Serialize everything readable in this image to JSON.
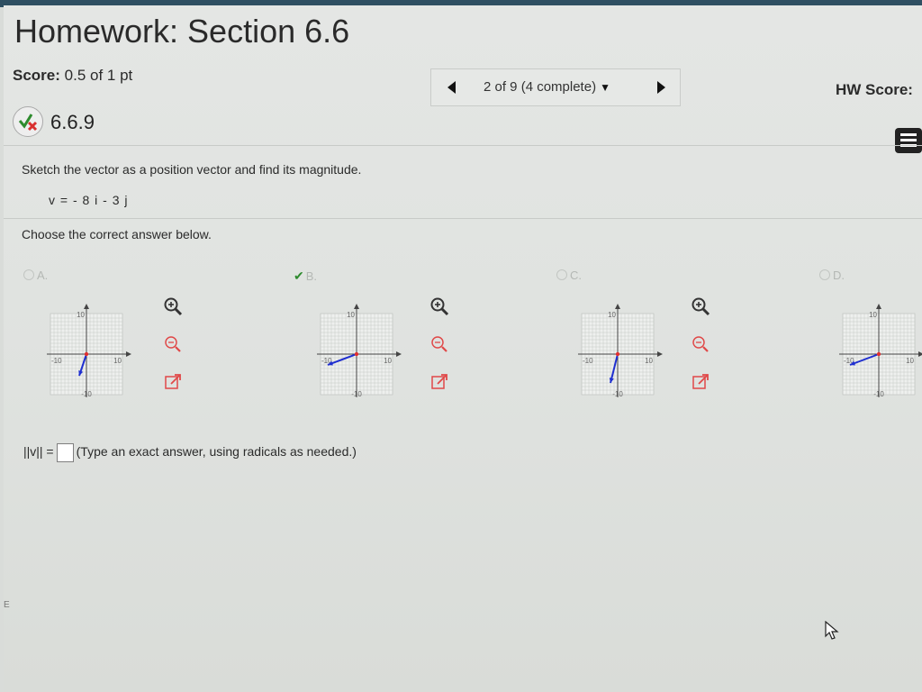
{
  "header": {
    "title": "Homework: Section 6.6",
    "score_label": "Score:",
    "score_value": "0.5 of 1 pt",
    "hw_score_label": "HW Score:"
  },
  "navigation": {
    "position_text": "2 of 9 (4 complete)",
    "dropdown_glyph": "▼"
  },
  "question": {
    "number": "6.6.9",
    "prompt": "Sketch the vector as a position vector and find its magnitude.",
    "equation": "v = - 8 i - 3 j",
    "instruction": "Choose the correct answer below."
  },
  "choices": [
    {
      "label": "A.",
      "selected": false,
      "ticks": {
        "top": "10",
        "left": "-10",
        "right": "10",
        "bottom": "-10"
      },
      "vector": [
        -2,
        -6
      ]
    },
    {
      "label": "B.",
      "selected": true,
      "ticks": {
        "top": "10",
        "left": "-10",
        "right": "10",
        "bottom": "-10"
      },
      "vector": [
        -8,
        -3
      ]
    },
    {
      "label": "C.",
      "selected": false,
      "ticks": {
        "top": "10",
        "left": "-10",
        "right": "10",
        "bottom": "-10"
      },
      "vector": [
        -2,
        -8
      ]
    },
    {
      "label": "D.",
      "selected": false,
      "ticks": {
        "top": "10",
        "left": "-10",
        "right": "10",
        "bottom": "-10"
      },
      "vector": [
        -8,
        -3
      ]
    }
  ],
  "answer": {
    "label": "||v|| =",
    "value": "",
    "hint": "(Type an exact answer, using radicals as needed.)"
  },
  "icons": {
    "incorrect_badge": "partial-check-icon",
    "list": "list-icon",
    "zoom_in": "zoom-in-icon",
    "zoom_out": "zoom-out-icon",
    "popout": "popout-icon",
    "cursor": "mouse-cursor-icon"
  },
  "colors": {
    "vector": "#1f2fd0",
    "origin": "#e03030",
    "correct": "#2e8b2e",
    "incorrect": "#d93030",
    "tool_accent": "#e04848"
  }
}
